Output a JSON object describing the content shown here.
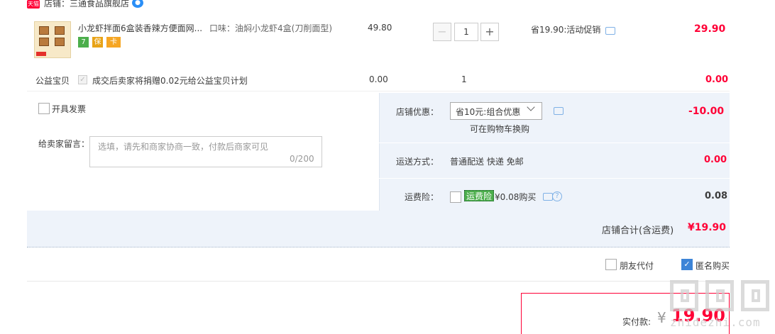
{
  "shop": {
    "badge": "天猫",
    "name": "店铺：三通食品旗舰店",
    "wangwang_icon": "chat-bubble"
  },
  "item": {
    "title": "小龙虾拌面6盒装香辣方便面网...",
    "sku": "口味：油焖小龙虾4盒(刀削面型)",
    "badges": [
      "7",
      "保",
      "卡"
    ],
    "unit_price": "49.80",
    "qty": "1",
    "qty_minus": "−",
    "qty_plus": "+",
    "promo": "省19.90:活动促销",
    "total": "29.90"
  },
  "charity": {
    "label": "公益宝贝",
    "text": "成交后卖家将捐赠0.02元给公益宝贝计划",
    "price": "0.00",
    "qty": "1",
    "total": "0.00"
  },
  "options": {
    "invoice_label": "开具发票",
    "message_label": "给卖家留言：",
    "message_placeholder": "选填，请先和商家协商一致，付款后商家可见",
    "message_count": "0/200",
    "coupon_label": "店铺优惠：",
    "coupon_value": "省10元:组合优惠",
    "coupon_note": "可在购物车换购",
    "coupon_total": "-10.00",
    "shipping_label": "运送方式：",
    "shipping_value": "普通配送 快递 免邮",
    "shipping_total": "0.00",
    "insurance_label": "运费险：",
    "insurance_tag": "运费险",
    "insurance_price": "¥0.08购买",
    "insurance_total": "0.08",
    "shop_total_label": "店铺合计(含运费)",
    "shop_total_value": "¥19.90"
  },
  "footer": {
    "friend_pay": "朋友代付",
    "anonymous": "匿名购买",
    "pay_label": "实付款:",
    "pay_currency": "¥",
    "pay_value": "19.90"
  },
  "watermark": "zhidezhi.com",
  "colors": {
    "price_red": "#ff0036",
    "panel_blue": "#eef3fa",
    "accent_blue": "#3d84d7"
  }
}
